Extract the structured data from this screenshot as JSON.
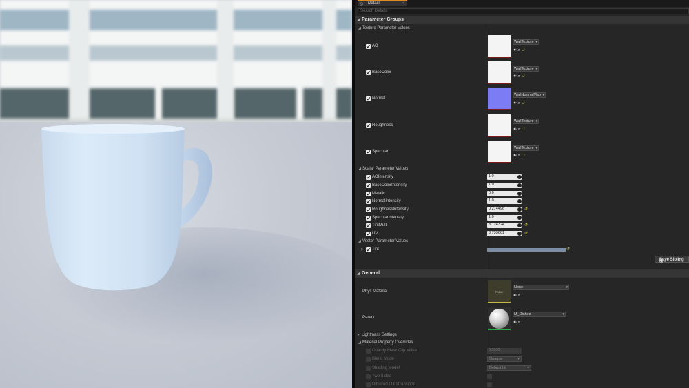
{
  "viewport": {},
  "details_tab": {
    "label": "Details",
    "icon": "details-icon",
    "close": "×"
  },
  "search": {
    "placeholder": "Search Details"
  },
  "parameter_groups": {
    "title": "Parameter Groups",
    "texture": {
      "title": "Texture Parameter Values",
      "items": [
        {
          "label": "AO",
          "asset": "WallTexture"
        },
        {
          "label": "BaseColor",
          "asset": "WallTexture"
        },
        {
          "label": "Normal",
          "asset": "WallNormalMap"
        },
        {
          "label": "Roughness",
          "asset": "WallTexture"
        },
        {
          "label": "Specular",
          "asset": "WallTexture"
        }
      ]
    },
    "scalar": {
      "title": "Scalar Parameter Values",
      "items": [
        {
          "label": "AOIntensity",
          "value": "1.0"
        },
        {
          "label": "BaseColorIntensity",
          "value": "1.0"
        },
        {
          "label": "Metalic",
          "value": "0.0"
        },
        {
          "label": "NormalIntensity",
          "value": "1.0"
        },
        {
          "label": "RoughnessIntensity",
          "value": "0.274496"
        },
        {
          "label": "SpecularIntensity",
          "value": "1.0"
        },
        {
          "label": "TintMulti",
          "value": "3.124324"
        },
        {
          "label": "UV",
          "value": "8.733661"
        }
      ]
    },
    "vector": {
      "title": "Vector Parameter Values",
      "items": [
        {
          "label": "Tint",
          "color": "#7b8ea6"
        }
      ]
    },
    "save_sibling": "Save Sibling"
  },
  "general": {
    "title": "General",
    "phys_material": {
      "label": "Phys Material",
      "thumb_text": "None",
      "value": "None"
    },
    "parent": {
      "label": "Parent",
      "value": "M_Dishes"
    }
  },
  "lightmass": {
    "title": "Lightmass Settings"
  },
  "overrides": {
    "title": "Material Property Overrides",
    "items": [
      {
        "label": "Opacity Mask Clip Value",
        "value": "0.3333"
      },
      {
        "label": "Blend Mode",
        "value": "Opaque"
      },
      {
        "label": "Shading Model",
        "value": "Default Lit"
      },
      {
        "label": "Two Sided"
      },
      {
        "label": "Dithered LODTransition"
      }
    ]
  },
  "colors": {
    "accent": "#e08a1e",
    "reset": "#c8c84a",
    "panel": "#262626"
  }
}
